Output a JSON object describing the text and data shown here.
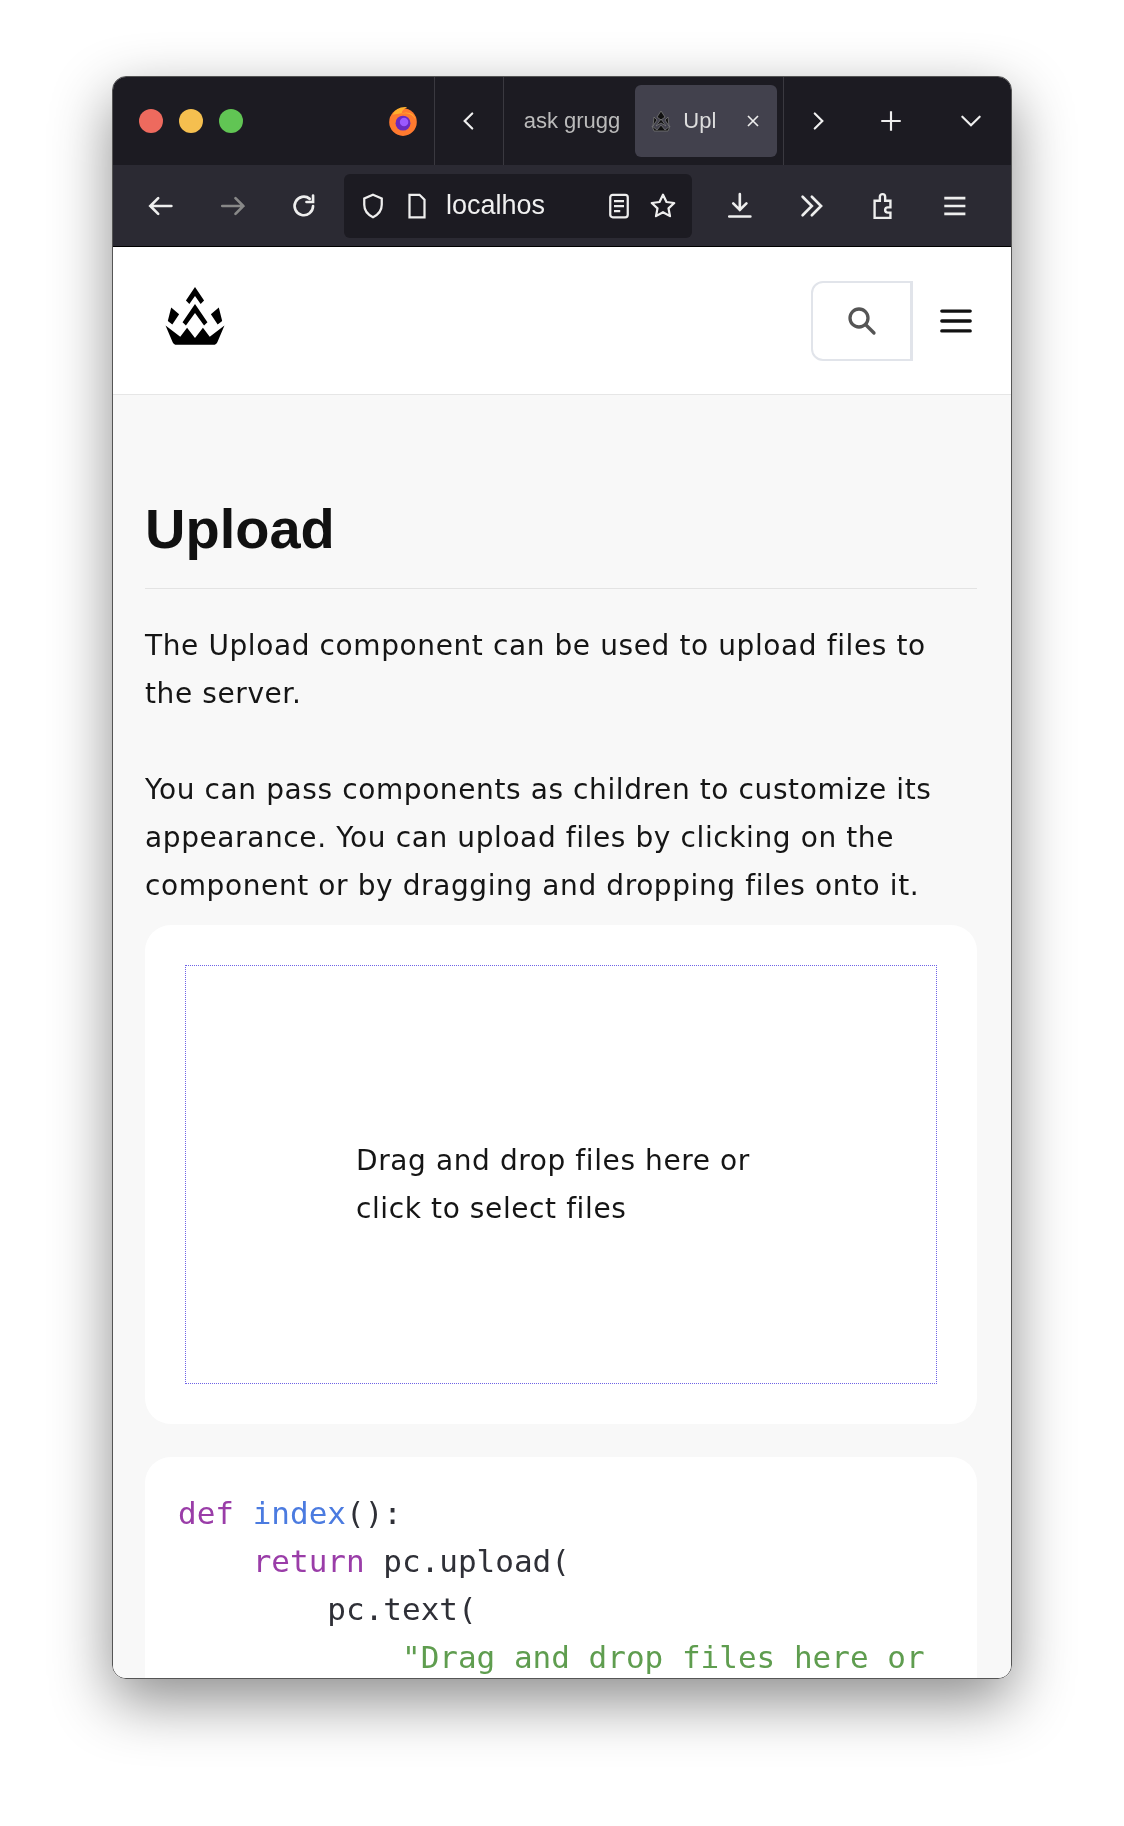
{
  "browser": {
    "tabs": [
      {
        "label": "ask grugg",
        "selected": false
      },
      {
        "label": "Upl",
        "selected": true
      }
    ],
    "url": "localhos"
  },
  "page": {
    "title": "Upload",
    "paragraphs": [
      "The Upload component can be used to upload files to the server.",
      "You can pass components as children to customize its appearance. You can upload files by clicking on the component or by dragging and dropping files onto it."
    ],
    "upload": {
      "prompt": "Drag and drop files here or click to select files"
    },
    "code": {
      "lines": [
        {
          "tokens": [
            {
              "kind": "keyword",
              "text": "def"
            },
            {
              "kind": "function",
              "text": " index"
            },
            {
              "kind": "plain",
              "text": "():"
            }
          ]
        },
        {
          "tokens": [
            {
              "kind": "keyword",
              "text": "    return"
            },
            {
              "kind": "plain",
              "text": " pc.upload("
            }
          ]
        },
        {
          "tokens": [
            {
              "kind": "plain",
              "text": "        pc.text("
            }
          ]
        },
        {
          "tokens": [
            {
              "kind": "string",
              "text": "            \"Drag and drop files here or"
            }
          ]
        }
      ]
    }
  }
}
